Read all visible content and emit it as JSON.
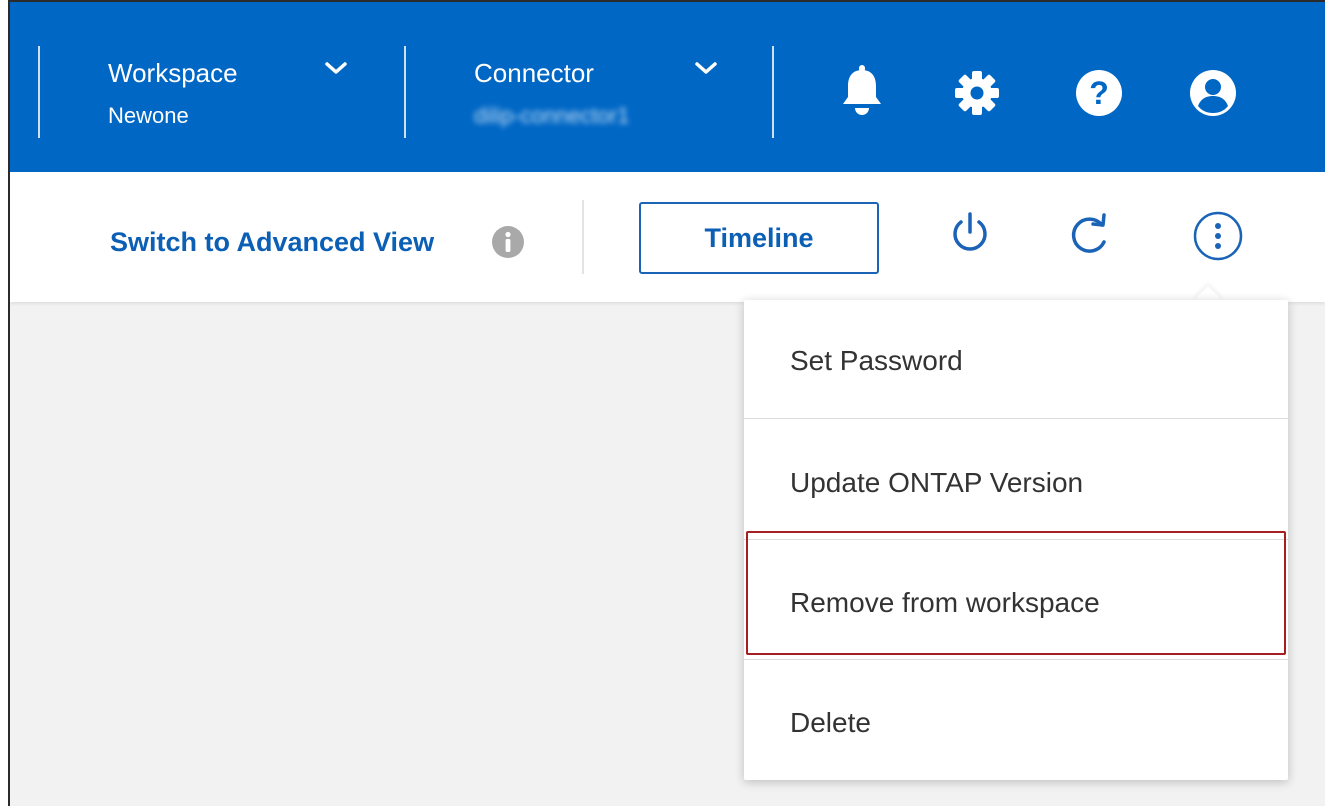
{
  "header": {
    "workspace": {
      "title": "Workspace",
      "value": "Newone"
    },
    "connector": {
      "title": "Connector",
      "value": "dilip-connector1"
    }
  },
  "toolbar": {
    "advanced_view_link": "Switch to Advanced View",
    "timeline_button": "Timeline"
  },
  "menu": {
    "items": [
      {
        "label": "Set Password"
      },
      {
        "label": "Update ONTAP Version"
      },
      {
        "label": "Remove from workspace"
      },
      {
        "label": "Delete"
      }
    ]
  },
  "icons": {
    "header": [
      "bell-icon",
      "gear-icon",
      "help-icon",
      "user-icon"
    ],
    "toolbar": [
      "info-icon",
      "power-icon",
      "refresh-icon",
      "more-vertical-icon"
    ]
  },
  "colors": {
    "header_bg": "#0067c5",
    "link": "#0b5fb5",
    "highlight": "#a41e22",
    "canvas": "#f2f2f2"
  }
}
